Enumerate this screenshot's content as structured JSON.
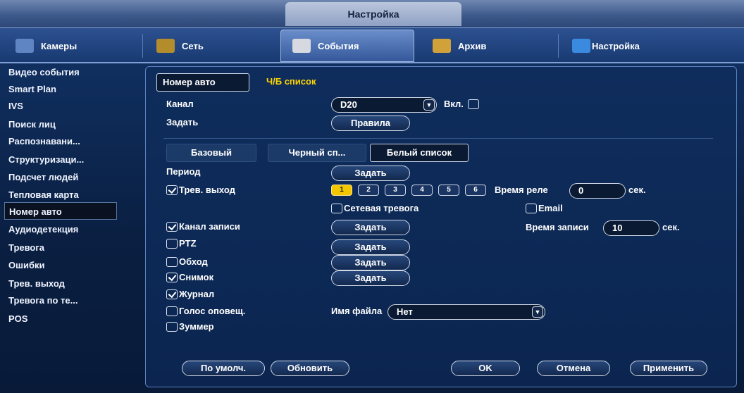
{
  "window": {
    "title": "Настройка"
  },
  "nav": [
    {
      "label": "Камеры",
      "icon": "camera-icon",
      "color": "#5f86c2"
    },
    {
      "label": "Сеть",
      "icon": "network-icon",
      "color": "#b38c2c"
    },
    {
      "label": "События",
      "icon": "events-icon",
      "color": "#d6d9df"
    },
    {
      "label": "Архив",
      "icon": "archive-icon",
      "color": "#d2a23a"
    },
    {
      "label": "Настройка",
      "icon": "settings-icon",
      "color": "#3a8be0"
    }
  ],
  "sidebar": {
    "items": [
      "Видео события",
      "Smart Plan",
      "IVS",
      "Поиск лиц",
      "Распознавани...",
      "Структуризаци...",
      "Подсчет людей",
      "Тепловая карта",
      "Номер авто",
      "Аудиодетекция",
      "Тревога",
      "Ошибки",
      "Трев. выход",
      "Тревога по те...",
      "POS"
    ],
    "active": "Номер авто"
  },
  "tabs": {
    "plate": "Номер авто",
    "bw": "Ч/Б список"
  },
  "form": {
    "channel_label": "Канал",
    "channel_value": "D20",
    "enable_label": "Вкл.",
    "set_label": "Задать",
    "rules_button": "Правила"
  },
  "subtabs": {
    "basic": "Базовый",
    "black": "Черный сп...",
    "white": "Белый список"
  },
  "period": {
    "label": "Период",
    "button": "Задать"
  },
  "alarm_out": {
    "label": "Трев. выход",
    "channels": [
      "1",
      "2",
      "3",
      "4",
      "5",
      "6"
    ],
    "relay_label": "Время реле",
    "relay_value": "0",
    "unit": "сек."
  },
  "net_alarm": {
    "label": "Сетевая тревога"
  },
  "email": {
    "label": "Email"
  },
  "record": {
    "label": "Канал записи",
    "button": "Задать",
    "time_label": "Время записи",
    "time_value": "10",
    "unit": "сек."
  },
  "ptz": {
    "label": "PTZ",
    "button": "Задать"
  },
  "tour": {
    "label": "Обход",
    "button": "Задать"
  },
  "snapshot": {
    "label": "Снимок",
    "button": "Задать"
  },
  "log": {
    "label": "Журнал"
  },
  "voice": {
    "label": "Голос оповещ.",
    "file_label": "Имя файла",
    "file_value": "Нет"
  },
  "buzzer": {
    "label": "Зуммер"
  },
  "footer": {
    "default": "По умолч.",
    "refresh": "Обновить",
    "ok": "OK",
    "cancel": "Отмена",
    "apply": "Применить"
  }
}
